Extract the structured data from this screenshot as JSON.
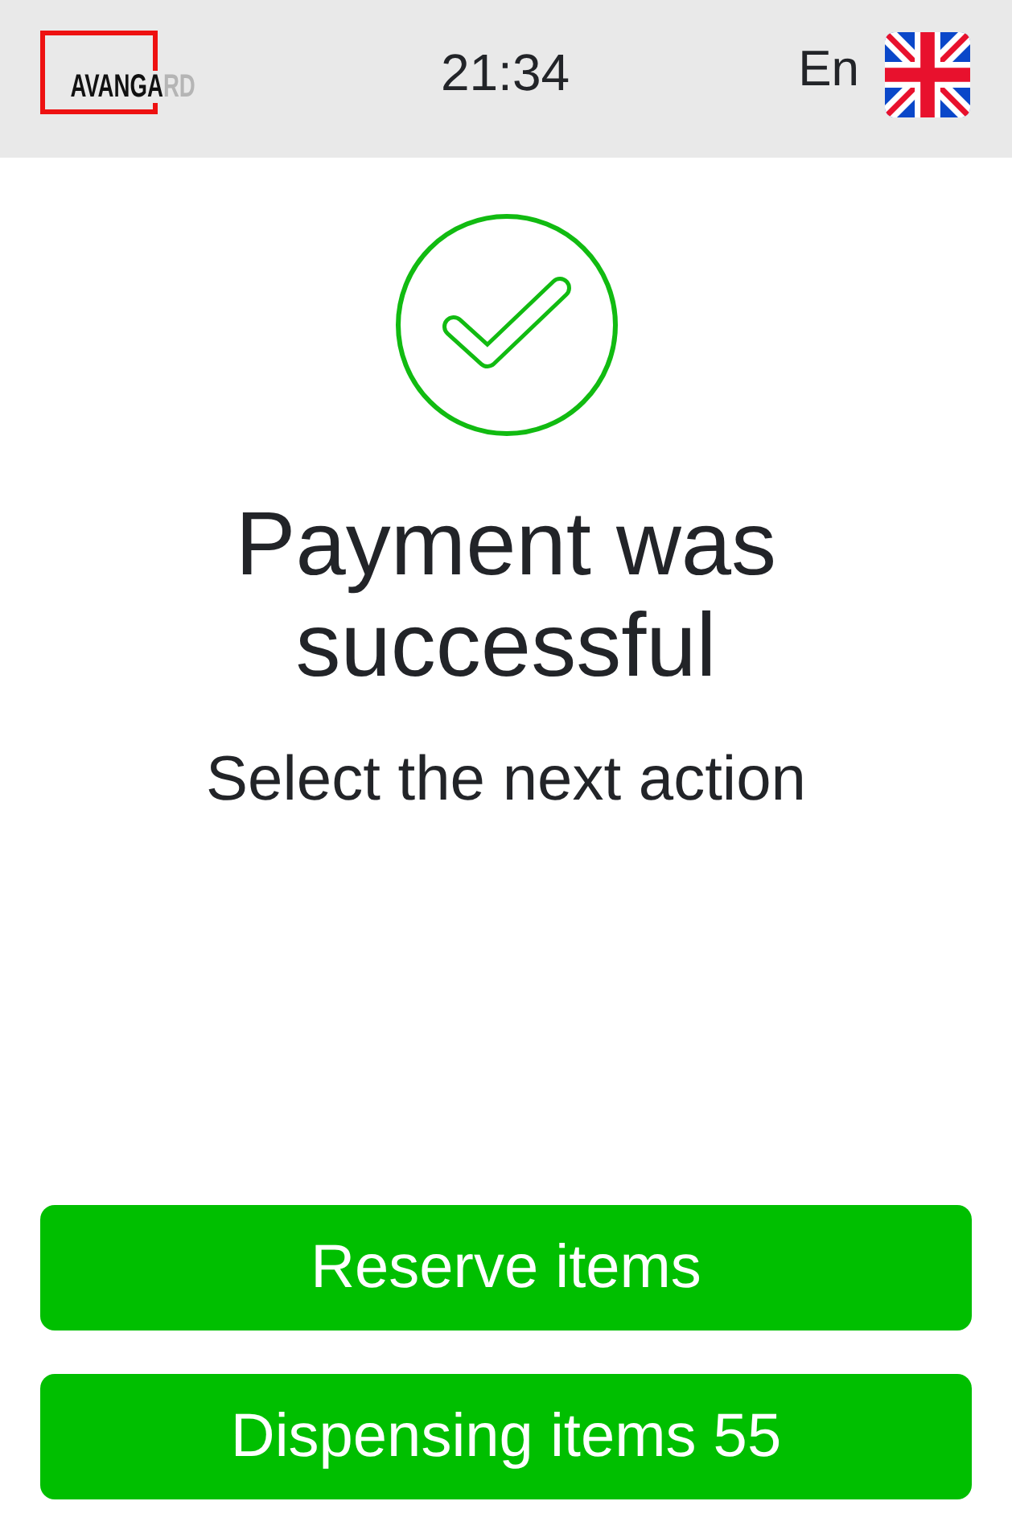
{
  "header": {
    "logo": {
      "text": "AVANGA",
      "faded_text": "RD"
    },
    "time": "21:34",
    "language": {
      "label": "En"
    }
  },
  "status": {
    "title": "Payment was successful",
    "subtitle": "Select the next action"
  },
  "actions": [
    {
      "label": "Reserve items"
    },
    {
      "label": "Dispensing items 55"
    }
  ]
}
